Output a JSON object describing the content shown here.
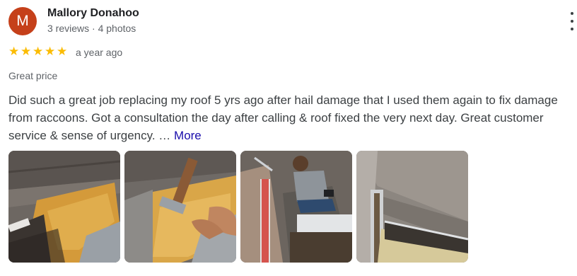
{
  "reviewer": {
    "initial": "M",
    "name": "Mallory Donahoo",
    "meta": "3 reviews · 4 photos",
    "avatar_color": "#c5401a"
  },
  "rating": {
    "stars": 5,
    "max": 5,
    "star_color": "#fbbc04",
    "date": "a year ago"
  },
  "tag": "Great price",
  "review": {
    "text": "Did such a great job replacing my roof 5 yrs ago after hail damage that I used them again to fix damage from raccoons. Got a consultation the day after calling & roof fixed the very next day. Great customer service & sense of urgency. …",
    "more_label": "More"
  },
  "menu_icon": "more-vert-icon",
  "photos_count": 4
}
